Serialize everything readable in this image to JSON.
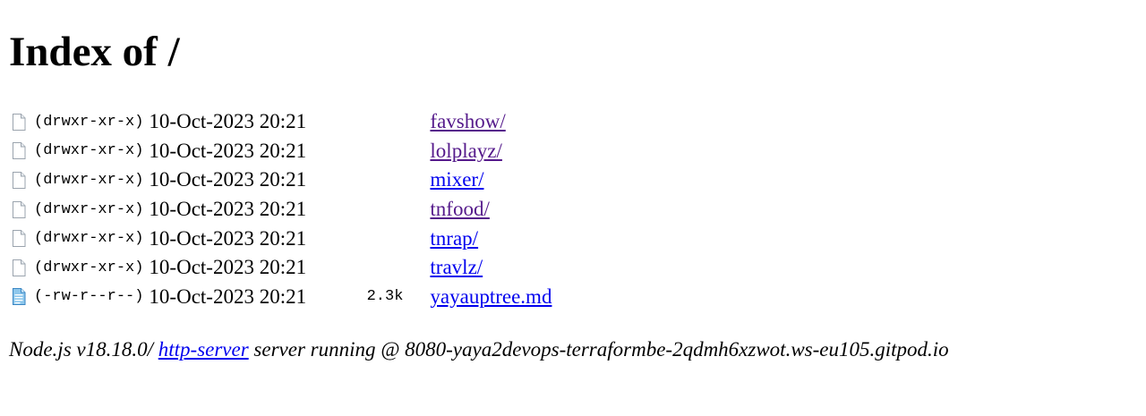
{
  "page": {
    "title": "Index of /"
  },
  "listing": {
    "entries": [
      {
        "icon": "file-icon",
        "permissions": "(drwxr-xr-x)",
        "date": "10-Oct-2023 20:21",
        "size": "",
        "name": "favshow/",
        "visited": true
      },
      {
        "icon": "file-icon",
        "permissions": "(drwxr-xr-x)",
        "date": "10-Oct-2023 20:21",
        "size": "",
        "name": "lolplayz/",
        "visited": true
      },
      {
        "icon": "file-icon",
        "permissions": "(drwxr-xr-x)",
        "date": "10-Oct-2023 20:21",
        "size": "",
        "name": "mixer/",
        "visited": false
      },
      {
        "icon": "file-icon",
        "permissions": "(drwxr-xr-x)",
        "date": "10-Oct-2023 20:21",
        "size": "",
        "name": "tnfood/",
        "visited": true
      },
      {
        "icon": "file-icon",
        "permissions": "(drwxr-xr-x)",
        "date": "10-Oct-2023 20:21",
        "size": "",
        "name": "tnrap/",
        "visited": false
      },
      {
        "icon": "file-icon",
        "permissions": "(drwxr-xr-x)",
        "date": "10-Oct-2023 20:21",
        "size": "",
        "name": "travlz/",
        "visited": false
      },
      {
        "icon": "text-file-icon",
        "permissions": "(-rw-r--r--)",
        "date": "10-Oct-2023 20:21",
        "size": "2.3k",
        "name": "yayauptree.md",
        "visited": false
      }
    ]
  },
  "footer": {
    "prefix": "Node.js v18.18.0/ ",
    "link_label": "http-server",
    "suffix": " server running @ 8080-yaya2devops-terraformbe-2qdmh6xzwot.ws-eu105.gitpod.io"
  },
  "colors": {
    "link": "#0000ee",
    "visited_link": "#551a8b"
  }
}
